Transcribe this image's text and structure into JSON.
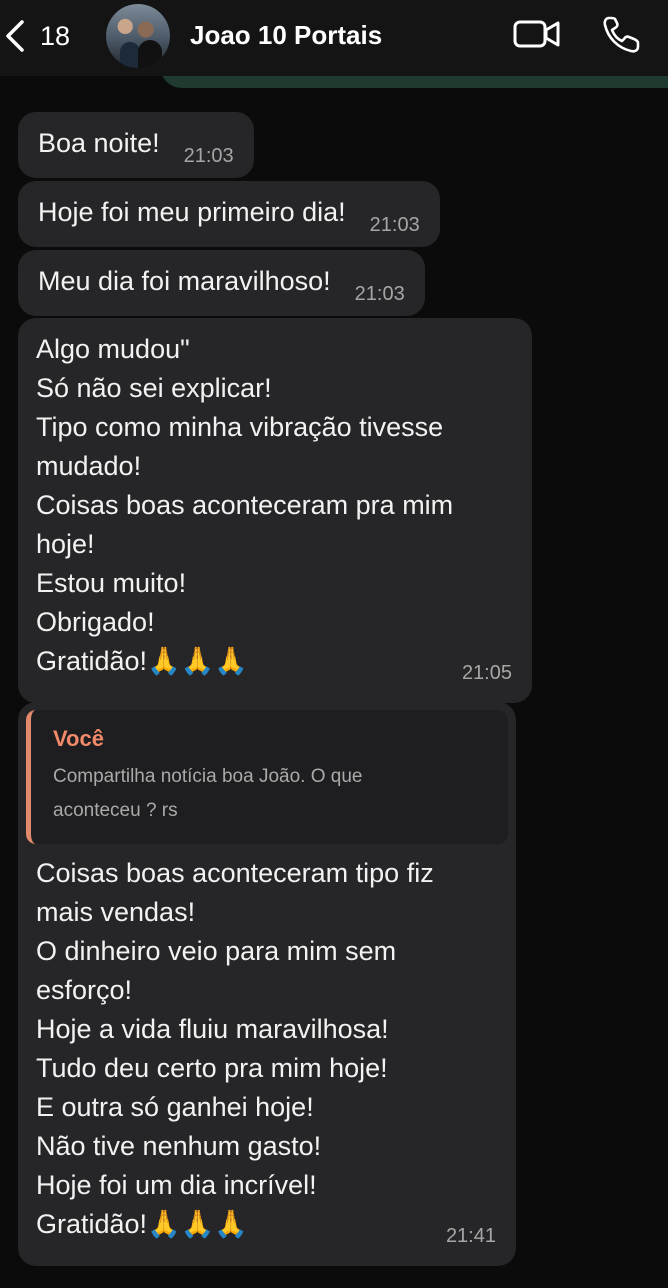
{
  "header": {
    "back_count": "18",
    "contact_name": "Joao 10 Portais",
    "video_icon": "video-camera-icon",
    "phone_icon": "phone-icon"
  },
  "messages": [
    {
      "text": "Boa noite!",
      "time": "21:03"
    },
    {
      "text": "Hoje foi meu primeiro dia!",
      "time": "21:03"
    },
    {
      "text": "Meu dia foi maravilhoso!",
      "time": "21:03"
    },
    {
      "text": "Algo mudou\"\nSó não sei explicar!\nTipo como minha vibração tivesse\nmudado!\nCoisas boas aconteceram pra mim\nhoje!\nEstou muito!\nObrigado!\nGratidão!🙏🙏🙏",
      "time": "21:05"
    },
    {
      "reply": {
        "author": "Você",
        "text": "Compartilha notícia boa João. O que\naconteceu ? rs"
      },
      "text": "Coisas boas aconteceram tipo fiz\nmais vendas!\nO dinheiro veio para mim sem\nesforço!\nHoje a vida fluiu maravilhosa!\nTudo deu certo pra mim hoje!\nE outra só ganhei hoje!\nNão tive nenhum gasto!\nHoje foi um dia incrível!\nGratidão!🙏🙏🙏",
      "time": "21:41"
    }
  ],
  "colors": {
    "bubble": "#262628",
    "header_accent": "#1f3a2e",
    "reply_accent": "#f08a68"
  }
}
